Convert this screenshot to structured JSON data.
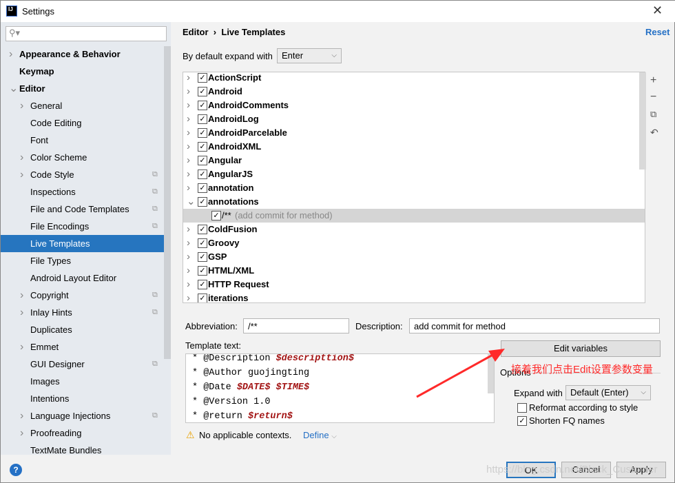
{
  "window": {
    "title": "Settings",
    "logo": "IJ"
  },
  "sidebar": {
    "items": [
      {
        "label": "Appearance & Behavior",
        "level": 0,
        "arrow": "right",
        "bold": true
      },
      {
        "label": "Keymap",
        "level": 0,
        "arrow": "",
        "bold": true
      },
      {
        "label": "Editor",
        "level": 0,
        "arrow": "down",
        "bold": true
      },
      {
        "label": "General",
        "level": 1,
        "arrow": "right"
      },
      {
        "label": "Code Editing",
        "level": 1,
        "arrow": ""
      },
      {
        "label": "Font",
        "level": 1,
        "arrow": ""
      },
      {
        "label": "Color Scheme",
        "level": 1,
        "arrow": "right"
      },
      {
        "label": "Code Style",
        "level": 1,
        "arrow": "right",
        "copy": true
      },
      {
        "label": "Inspections",
        "level": 1,
        "arrow": "",
        "copy": true
      },
      {
        "label": "File and Code Templates",
        "level": 1,
        "arrow": "",
        "copy": true
      },
      {
        "label": "File Encodings",
        "level": 1,
        "arrow": "",
        "copy": true
      },
      {
        "label": "Live Templates",
        "level": 1,
        "arrow": "",
        "selected": true
      },
      {
        "label": "File Types",
        "level": 1,
        "arrow": ""
      },
      {
        "label": "Android Layout Editor",
        "level": 1,
        "arrow": ""
      },
      {
        "label": "Copyright",
        "level": 1,
        "arrow": "right",
        "copy": true
      },
      {
        "label": "Inlay Hints",
        "level": 1,
        "arrow": "right",
        "copy": true
      },
      {
        "label": "Duplicates",
        "level": 1,
        "arrow": ""
      },
      {
        "label": "Emmet",
        "level": 1,
        "arrow": "right"
      },
      {
        "label": "GUI Designer",
        "level": 1,
        "arrow": "",
        "copy": true
      },
      {
        "label": "Images",
        "level": 1,
        "arrow": ""
      },
      {
        "label": "Intentions",
        "level": 1,
        "arrow": ""
      },
      {
        "label": "Language Injections",
        "level": 1,
        "arrow": "right",
        "copy": true
      },
      {
        "label": "Proofreading",
        "level": 1,
        "arrow": "right"
      },
      {
        "label": "TextMate Bundles",
        "level": 1,
        "arrow": ""
      }
    ]
  },
  "breadcrumb": {
    "parent": "Editor",
    "sep": "›",
    "current": "Live Templates"
  },
  "reset_label": "Reset",
  "expand_default": {
    "label": "By default expand with",
    "value": "Enter"
  },
  "tree": [
    {
      "label": "ActionScript",
      "arrow": "right",
      "checked": true
    },
    {
      "label": "Android",
      "arrow": "right",
      "checked": true
    },
    {
      "label": "AndroidComments",
      "arrow": "right",
      "checked": true
    },
    {
      "label": "AndroidLog",
      "arrow": "right",
      "checked": true
    },
    {
      "label": "AndroidParcelable",
      "arrow": "right",
      "checked": true
    },
    {
      "label": "AndroidXML",
      "arrow": "right",
      "checked": true
    },
    {
      "label": "Angular",
      "arrow": "right",
      "checked": true
    },
    {
      "label": "AngularJS",
      "arrow": "right",
      "checked": true
    },
    {
      "label": "annotation",
      "arrow": "right",
      "checked": true
    },
    {
      "label": "annotations",
      "arrow": "down",
      "checked": true
    },
    {
      "label": "/**",
      "desc": "(add commit for method)",
      "child": true,
      "checked": true,
      "selected": true
    },
    {
      "label": "ColdFusion",
      "arrow": "right",
      "checked": true
    },
    {
      "label": "Groovy",
      "arrow": "right",
      "checked": true
    },
    {
      "label": "GSP",
      "arrow": "right",
      "checked": true
    },
    {
      "label": "HTML/XML",
      "arrow": "right",
      "checked": true
    },
    {
      "label": "HTTP Request",
      "arrow": "right",
      "checked": true
    },
    {
      "label": "iterations",
      "arrow": "right",
      "checked": true
    }
  ],
  "form": {
    "abbreviation_label": "Abbreviation:",
    "abbreviation": "/**",
    "description_label": "Description:",
    "description": "add commit for method",
    "template_label": "Template text:"
  },
  "code": [
    [
      {
        "t": "* @Description "
      },
      {
        "t": "$descripttion$",
        "v": true
      }
    ],
    [
      {
        "t": "* @Author guojingting"
      }
    ],
    [
      {
        "t": "* @Date "
      },
      {
        "t": "$DATE$",
        "v": true
      },
      {
        "t": " "
      },
      {
        "t": "$TIME$",
        "v": true
      }
    ],
    [
      {
        "t": "* @Version 1.0"
      }
    ],
    [
      {
        "t": "* @return "
      },
      {
        "t": "$return$",
        "v": true
      }
    ]
  ],
  "edit_variables": "Edit variables",
  "annotation": "接着我们点击Edit设置参数变量",
  "options": {
    "title": "Options",
    "expand_label": "Expand with",
    "expand_value": "Default (Enter)",
    "reformat": "Reformat according to style",
    "reformat_checked": false,
    "shorten": "Shorten FQ names",
    "shorten_checked": true
  },
  "contexts": {
    "warning": "No applicable contexts.",
    "define": "Define"
  },
  "buttons": {
    "ok": "OK",
    "cancel": "Cancel",
    "apply": "Apply",
    "help": "?"
  },
  "watermark": "https://blog.csdn.net/Black_Customer",
  "colors": {
    "accent": "#2675bf",
    "link": "#2470c5",
    "variable": "#a31515",
    "annotation": "#ff2a2a"
  }
}
